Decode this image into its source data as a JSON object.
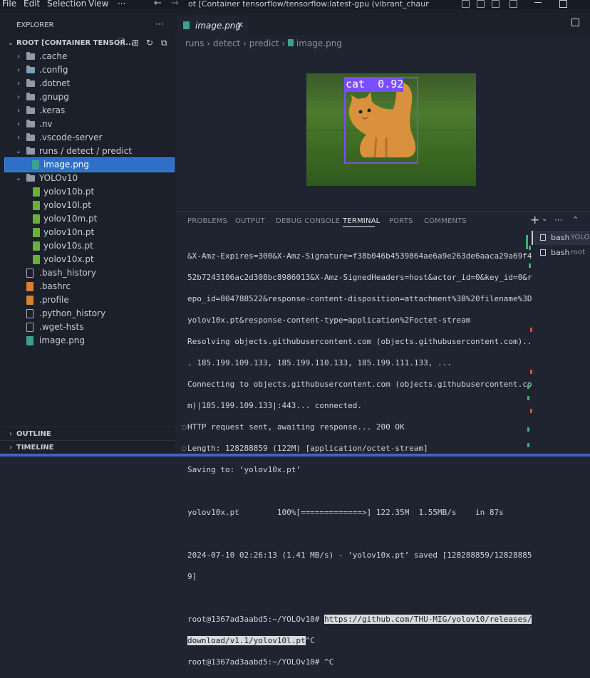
{
  "menu": [
    "File",
    "Edit",
    "Selection",
    "View",
    "···"
  ],
  "window_title": "ot [Container tensorflow/tensorflow:latest-gpu (vibrant_chaum) @ desktop",
  "sidebar": {
    "header": "EXPLORER",
    "more": "···",
    "root_label": "ROOT [CONTAINER TENSOR...",
    "items": [
      {
        "label": ".cache",
        "kind": "folder",
        "chev": "›"
      },
      {
        "label": ".config",
        "kind": "folder",
        "chev": "›"
      },
      {
        "label": ".dotnet",
        "kind": "folder",
        "chev": "›"
      },
      {
        "label": ".gnupg",
        "kind": "folder",
        "chev": "›"
      },
      {
        "label": ".keras",
        "kind": "folder",
        "chev": "›"
      },
      {
        "label": ".nv",
        "kind": "folder",
        "chev": "›"
      },
      {
        "label": ".vscode-server",
        "kind": "folder",
        "chev": "›"
      },
      {
        "label": "runs / detect / predict",
        "kind": "folder",
        "chev": "⌄"
      },
      {
        "label": "image.png",
        "kind": "image"
      },
      {
        "label": "YOLOv10",
        "kind": "folder",
        "chev": "⌄"
      },
      {
        "label": "yolov10b.pt",
        "kind": "pt"
      },
      {
        "label": "yolov10l.pt",
        "kind": "pt"
      },
      {
        "label": "yolov10m.pt",
        "kind": "pt"
      },
      {
        "label": "yolov10n.pt",
        "kind": "pt"
      },
      {
        "label": "yolov10s.pt",
        "kind": "pt"
      },
      {
        "label": "yolov10x.pt",
        "kind": "pt"
      },
      {
        "label": ".bash_history",
        "kind": "file"
      },
      {
        "label": ".bashrc",
        "kind": "shell"
      },
      {
        "label": ".profile",
        "kind": "shell"
      },
      {
        "label": ".python_history",
        "kind": "file"
      },
      {
        "label": ".wget-hsts",
        "kind": "file"
      },
      {
        "label": "image.png",
        "kind": "image"
      }
    ],
    "outline": "OUTLINE",
    "timeline": "TIMELINE"
  },
  "editor": {
    "tab_label": "image.png",
    "close": "✕",
    "breadcrumb": [
      "runs",
      "detect",
      "predict",
      "image.png"
    ],
    "detection_label": "cat  0.92"
  },
  "panel": {
    "tabs": [
      "PROBLEMS",
      "OUTPUT",
      "DEBUG CONSOLE",
      "TERMINAL",
      "PORTS",
      "COMMENTS"
    ],
    "active_tab": "TERMINAL",
    "terminals": [
      {
        "name": "bash",
        "detail": "YOLOv"
      },
      {
        "name": "bash",
        "detail": "root"
      }
    ],
    "lines": [
      "&X-Amz-Expires=300&X-Amz-Signature=f38b046b4539864ae6a9e263de6aaca29a69f4",
      "52b7243106ac2d308bc8986013&X-Amz-SignedHeaders=host&actor_id=0&key_id=0&r",
      "epo_id=804788522&response-content-disposition=attachment%3B%20filename%3D",
      "yolov10x.pt&response-content-type=application%2Foctet-stream",
      "Resolving objects.githubusercontent.com (objects.githubusercontent.com)..",
      ". 185.199.109.133, 185.199.110.133, 185.199.111.133, ...",
      "Connecting to objects.githubusercontent.com (objects.githubusercontent.co",
      "m)|185.199.109.133|:443... connected.",
      "HTTP request sent, awaiting response... 200 OK",
      "Length: 128288859 (122M) [application/octet-stream]",
      "Saving to: ‘yolov10x.pt’",
      "",
      "yolov10x.pt        100%[=============>] 122.35M  1.55MB/s    in 87s",
      "",
      "2024-07-10 02:26:13 (1.41 MB/s) - ‘yolov10x.pt’ saved [128288859/12828885",
      "9]",
      ""
    ],
    "prompt1": "root@1367ad3aabd5:~/YOLOv10# ",
    "selected1": "https://github.com/THU-MIG/yolov10/releases/",
    "selected2": "download/v1.1/yolov10l.pt",
    "ctrlc": "^C",
    "prompt2": "root@1367ad3aabd5:~/YOLOv10# ^C"
  }
}
